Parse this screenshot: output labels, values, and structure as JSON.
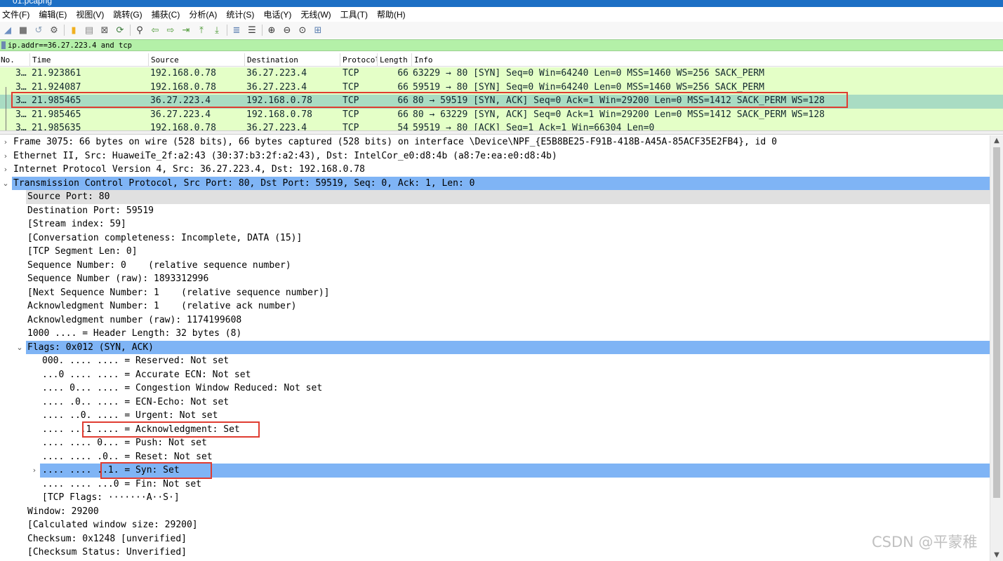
{
  "window": {
    "title": "01.pcapng"
  },
  "menu": [
    "文件(F)",
    "编辑(E)",
    "视图(V)",
    "跳转(G)",
    "捕获(C)",
    "分析(A)",
    "统计(S)",
    "电话(Y)",
    "无线(W)",
    "工具(T)",
    "帮助(H)"
  ],
  "toolbar_icons": [
    {
      "name": "shark-fin-start-icon",
      "glyph": "◢",
      "color": "#6d8fc2"
    },
    {
      "name": "stop-capture-icon",
      "glyph": "■",
      "color": "#7a7a7a"
    },
    {
      "name": "restart-capture-icon",
      "glyph": "↺",
      "color": "#8aa0b8"
    },
    {
      "name": "capture-options-icon",
      "glyph": "⚙",
      "color": "#555555"
    },
    {
      "name": "open-file-icon",
      "glyph": "▮",
      "color": "#f0b020"
    },
    {
      "name": "save-file-icon",
      "glyph": "▤",
      "color": "#8a8a8a"
    },
    {
      "name": "close-file-icon",
      "glyph": "⊠",
      "color": "#555555"
    },
    {
      "name": "reload-file-icon",
      "glyph": "⟳",
      "color": "#3a7a3a"
    },
    {
      "name": "find-packet-icon",
      "glyph": "⚲",
      "color": "#333333"
    },
    {
      "name": "go-back-icon",
      "glyph": "⇦",
      "color": "#4f9a38"
    },
    {
      "name": "go-forward-icon",
      "glyph": "⇨",
      "color": "#4f9a38"
    },
    {
      "name": "go-to-packet-icon",
      "glyph": "⇥",
      "color": "#4f9a38"
    },
    {
      "name": "go-first-icon",
      "glyph": "⤒",
      "color": "#4f9a38"
    },
    {
      "name": "go-last-icon",
      "glyph": "⤓",
      "color": "#4f9a38"
    },
    {
      "name": "autoscroll-icon",
      "glyph": "≣",
      "color": "#5b7fb0"
    },
    {
      "name": "colorize-icon",
      "glyph": "☰",
      "color": "#333333"
    },
    {
      "name": "zoom-in-icon",
      "glyph": "⊕",
      "color": "#333333"
    },
    {
      "name": "zoom-out-icon",
      "glyph": "⊖",
      "color": "#333333"
    },
    {
      "name": "zoom-normal-icon",
      "glyph": "⊙",
      "color": "#333333"
    },
    {
      "name": "resize-columns-icon",
      "glyph": "⊞",
      "color": "#5b7fb0"
    }
  ],
  "filter": {
    "value": "ip.addr==36.27.223.4 and tcp"
  },
  "packet_list": {
    "columns": [
      "No.",
      "Time",
      "Source",
      "Destination",
      "Protocol",
      "Length",
      "Info"
    ],
    "rows": [
      {
        "no": "3…",
        "time": "21.923861",
        "src": "192.168.0.78",
        "dst": "36.27.223.4",
        "proto": "TCP",
        "len": "66",
        "info": "63229 → 80 [SYN] Seq=0 Win=64240 Len=0 MSS=1460 WS=256 SACK_PERM",
        "selected": false
      },
      {
        "no": "3…",
        "time": "21.924087",
        "src": "192.168.0.78",
        "dst": "36.27.223.4",
        "proto": "TCP",
        "len": "66",
        "info": "59519 → 80 [SYN] Seq=0 Win=64240 Len=0 MSS=1460 WS=256 SACK_PERM",
        "selected": false
      },
      {
        "no": "3…",
        "time": "21.985465",
        "src": "36.27.223.4",
        "dst": "192.168.0.78",
        "proto": "TCP",
        "len": "66",
        "info": "80 → 59519 [SYN, ACK] Seq=0 Ack=1 Win=29200 Len=0 MSS=1412 SACK_PERM WS=128",
        "selected": true
      },
      {
        "no": "3…",
        "time": "21.985465",
        "src": "36.27.223.4",
        "dst": "192.168.0.78",
        "proto": "TCP",
        "len": "66",
        "info": "80 → 63229 [SYN, ACK] Seq=0 Ack=1 Win=29200 Len=0 MSS=1412 SACK_PERM WS=128",
        "selected": false
      },
      {
        "no": "3…",
        "time": "21.985635",
        "src": "192.168.0.78",
        "dst": "36.27.223.4",
        "proto": "TCP",
        "len": "54",
        "info": "59519 → 80 [ACK] Seq=1 Ack=1 Win=66304 Len=0",
        "selected": false
      }
    ]
  },
  "details": [
    {
      "level": 0,
      "arrow": "›",
      "text": "Frame 3075: 66 bytes on wire (528 bits), 66 bytes captured (528 bits) on interface \\Device\\NPF_{E5B8BE25-F91B-418B-A45A-85ACF35E2FB4}, id 0"
    },
    {
      "level": 0,
      "arrow": "›",
      "text": "Ethernet II, Src: HuaweiTe_2f:a2:43 (30:37:b3:2f:a2:43), Dst: IntelCor_e0:d8:4b (a8:7e:ea:e0:d8:4b)"
    },
    {
      "level": 0,
      "arrow": "›",
      "text": "Internet Protocol Version 4, Src: 36.27.223.4, Dst: 192.168.0.78"
    },
    {
      "level": 0,
      "arrow": "⌄",
      "text": "Transmission Control Protocol, Src Port: 80, Dst Port: 59519, Seq: 0, Ack: 1, Len: 0",
      "style": "hl"
    },
    {
      "level": 1,
      "arrow": "",
      "text": "Source Port: 80",
      "style": "grey"
    },
    {
      "level": 1,
      "arrow": "",
      "text": "Destination Port: 59519"
    },
    {
      "level": 1,
      "arrow": "",
      "text": "[Stream index: 59]"
    },
    {
      "level": 1,
      "arrow": "",
      "text": "[Conversation completeness: Incomplete, DATA (15)]"
    },
    {
      "level": 1,
      "arrow": "",
      "text": "[TCP Segment Len: 0]"
    },
    {
      "level": 1,
      "arrow": "",
      "text": "Sequence Number: 0    (relative sequence number)"
    },
    {
      "level": 1,
      "arrow": "",
      "text": "Sequence Number (raw): 1893312996"
    },
    {
      "level": 1,
      "arrow": "",
      "text": "[Next Sequence Number: 1    (relative sequence number)]"
    },
    {
      "level": 1,
      "arrow": "",
      "text": "Acknowledgment Number: 1    (relative ack number)"
    },
    {
      "level": 1,
      "arrow": "",
      "text": "Acknowledgment number (raw): 1174199608"
    },
    {
      "level": 1,
      "arrow": "",
      "text": "1000 .... = Header Length: 32 bytes (8)"
    },
    {
      "level": 1,
      "arrow": "⌄",
      "text": "Flags: 0x012 (SYN, ACK)",
      "style": "hl"
    },
    {
      "level": 2,
      "arrow": "",
      "text": "000. .... .... = Reserved: Not set"
    },
    {
      "level": 2,
      "arrow": "",
      "text": "...0 .... .... = Accurate ECN: Not set"
    },
    {
      "level": 2,
      "arrow": "",
      "text": ".... 0... .... = Congestion Window Reduced: Not set"
    },
    {
      "level": 2,
      "arrow": "",
      "text": ".... .0.. .... = ECN-Echo: Not set"
    },
    {
      "level": 2,
      "arrow": "",
      "text": ".... ..0. .... = Urgent: Not set"
    },
    {
      "level": 2,
      "arrow": "",
      "text": ".... ...1 .... = Acknowledgment: Set"
    },
    {
      "level": 2,
      "arrow": "",
      "text": ".... .... 0... = Push: Not set"
    },
    {
      "level": 2,
      "arrow": "",
      "text": ".... .... .0.. = Reset: Not set"
    },
    {
      "level": 2,
      "arrow": "›",
      "text": ".... .... ..1. = Syn: Set",
      "style": "hl"
    },
    {
      "level": 2,
      "arrow": "",
      "text": ".... .... ...0 = Fin: Not set"
    },
    {
      "level": 2,
      "arrow": "",
      "text": "[TCP Flags: ·······A··S·]"
    },
    {
      "level": 1,
      "arrow": "",
      "text": "Window: 29200"
    },
    {
      "level": 1,
      "arrow": "",
      "text": "[Calculated window size: 29200]"
    },
    {
      "level": 1,
      "arrow": "",
      "text": "Checksum: 0x1248 [unverified]"
    },
    {
      "level": 1,
      "arrow": "",
      "text": "[Checksum Status: Unverified]"
    }
  ],
  "watermark": "CSDN @平蒙稚"
}
